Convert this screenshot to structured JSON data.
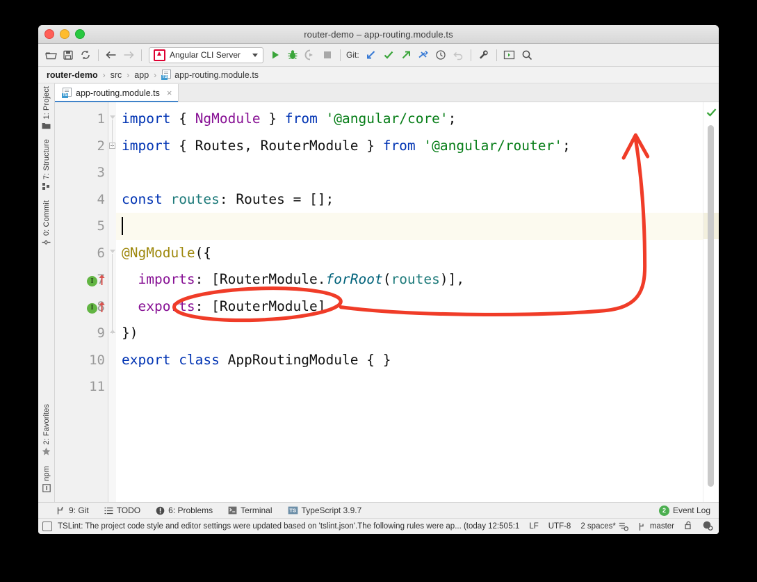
{
  "window": {
    "title": "router-demo – app-routing.module.ts",
    "traffic_lights": [
      "close",
      "minimize",
      "maximize"
    ]
  },
  "toolbar": {
    "left_icons": [
      "open-folder-icon",
      "save-icon",
      "sync-icon",
      "back-arrow-icon",
      "forward-arrow-icon"
    ],
    "run_config": {
      "label": "Angular CLI Server",
      "icon": "angular-icon",
      "dropdown": "chevron-down-icon"
    },
    "run_icons": [
      "run-icon",
      "debug-icon",
      "run-coverage-icon",
      "stop-icon"
    ],
    "git_label": "Git:",
    "git_icons": [
      "update-project-icon",
      "commit-icon",
      "push-icon",
      "fetch-icon",
      "history-icon",
      "rollback-icon"
    ],
    "right_icons": [
      "settings-wrench-icon",
      "terminal-panel-icon",
      "search-icon"
    ]
  },
  "breadcrumb": {
    "items": [
      "router-demo",
      "src",
      "app",
      "app-routing.module.ts"
    ],
    "separator": "›",
    "file_icon": "ts-file-icon"
  },
  "tabs": [
    {
      "label": "app-routing.module.ts",
      "icon": "ts-file-icon",
      "close": "×",
      "active": true
    }
  ],
  "toolstrip": {
    "top": [
      {
        "label": "1: Project",
        "icon": "project-folder-icon"
      },
      {
        "label": "7: Structure",
        "icon": "structure-icon"
      },
      {
        "label": "0: Commit",
        "icon": "commit-icon"
      }
    ],
    "bottom": [
      {
        "label": "2: Favorites",
        "icon": "star-icon"
      },
      {
        "label": "npm",
        "icon": "npm-icon"
      }
    ]
  },
  "editor": {
    "line_numbers": [
      "1",
      "2",
      "3",
      "4",
      "5",
      "6",
      "7",
      "8",
      "9",
      "10",
      "11"
    ],
    "caret_line": 5,
    "caret_position": "5:1",
    "gutter_markers": [
      {
        "line": 7,
        "type": "implemented",
        "letter": "I",
        "arrow": "up"
      },
      {
        "line": 8,
        "type": "implemented",
        "letter": "I",
        "arrow": "up"
      }
    ],
    "inspection_status": "ok-check-icon",
    "lines": [
      {
        "n": 1,
        "tokens": [
          {
            "t": "import",
            "c": "kw"
          },
          {
            "t": " { ",
            "c": "pl"
          },
          {
            "t": "NgModule",
            "c": "cls"
          },
          {
            "t": " } ",
            "c": "pl"
          },
          {
            "t": "from",
            "c": "kw"
          },
          {
            "t": " ",
            "c": "pl"
          },
          {
            "t": "'@angular/core'",
            "c": "str"
          },
          {
            "t": ";",
            "c": "pl"
          }
        ]
      },
      {
        "n": 2,
        "tokens": [
          {
            "t": "import",
            "c": "kw"
          },
          {
            "t": " { Routes, RouterModule } ",
            "c": "pl"
          },
          {
            "t": "from",
            "c": "kw"
          },
          {
            "t": " ",
            "c": "pl"
          },
          {
            "t": "'@angular/router'",
            "c": "str"
          },
          {
            "t": ";",
            "c": "pl"
          }
        ]
      },
      {
        "n": 3,
        "tokens": []
      },
      {
        "n": 4,
        "tokens": [
          {
            "t": "const",
            "c": "kw"
          },
          {
            "t": " ",
            "c": "pl"
          },
          {
            "t": "routes",
            "c": "teal"
          },
          {
            "t": ": Routes = [];",
            "c": "pl"
          }
        ]
      },
      {
        "n": 5,
        "tokens": []
      },
      {
        "n": 6,
        "tokens": [
          {
            "t": "@NgModule",
            "c": "ann"
          },
          {
            "t": "({",
            "c": "pl"
          }
        ]
      },
      {
        "n": 7,
        "tokens": [
          {
            "t": "  ",
            "c": "pl"
          },
          {
            "t": "imports",
            "c": "fld"
          },
          {
            "t": ": [RouterModule.",
            "c": "pl"
          },
          {
            "t": "forRoot",
            "c": "ital"
          },
          {
            "t": "(",
            "c": "pl"
          },
          {
            "t": "routes",
            "c": "teal"
          },
          {
            "t": ")],",
            "c": "pl"
          }
        ]
      },
      {
        "n": 8,
        "tokens": [
          {
            "t": "  ",
            "c": "pl"
          },
          {
            "t": "exports",
            "c": "fld"
          },
          {
            "t": ": [RouterModule]",
            "c": "pl"
          }
        ]
      },
      {
        "n": 9,
        "tokens": [
          {
            "t": "})",
            "c": "pl"
          }
        ]
      },
      {
        "n": 10,
        "tokens": [
          {
            "t": "export",
            "c": "kw"
          },
          {
            "t": " ",
            "c": "pl"
          },
          {
            "t": "class",
            "c": "kw"
          },
          {
            "t": " AppRoutingModule { }",
            "c": "pl"
          }
        ]
      },
      {
        "n": 11,
        "tokens": []
      }
    ]
  },
  "annotation": {
    "color": "#f03c28",
    "shapes": [
      "ellipse-around-RouterModule",
      "curved-arrow-to-angular-router"
    ],
    "ellipse_target": "[RouterModule]",
    "arrow_target": "'@angular/router'"
  },
  "tool_window_bar": {
    "items": [
      {
        "label": "9: Git",
        "num": "9",
        "rest": ": Git",
        "icon": "git-branch-icon"
      },
      {
        "label": "TODO",
        "num": "",
        "rest": "TODO",
        "icon": "todo-list-icon"
      },
      {
        "label": "6: Problems",
        "num": "6",
        "rest": ": Problems",
        "icon": "problems-icon"
      },
      {
        "label": "Terminal",
        "num": "",
        "rest": "Terminal",
        "icon": "terminal-icon"
      },
      {
        "label": "TypeScript 3.9.7",
        "num": "",
        "rest": "TypeScript 3.9.7",
        "icon": "ts-badge-icon"
      }
    ],
    "event_log": {
      "label": "Event Log",
      "count": "2"
    }
  },
  "statusbar": {
    "message": "TSLint: The project code style and editor settings were updated based on 'tslint.json'.The following rules were ap... (today 12:50",
    "message_icon": "status-square-icon",
    "caret": "5:1",
    "line_separator": "LF",
    "encoding": "UTF-8",
    "indent": "2 spaces*",
    "indent_icon": "indent-config-icon",
    "branch": "master",
    "branch_icon": "git-branch-icon",
    "lock_icon": "unlocked-icon",
    "inspections_icon": "inspections-icon"
  }
}
